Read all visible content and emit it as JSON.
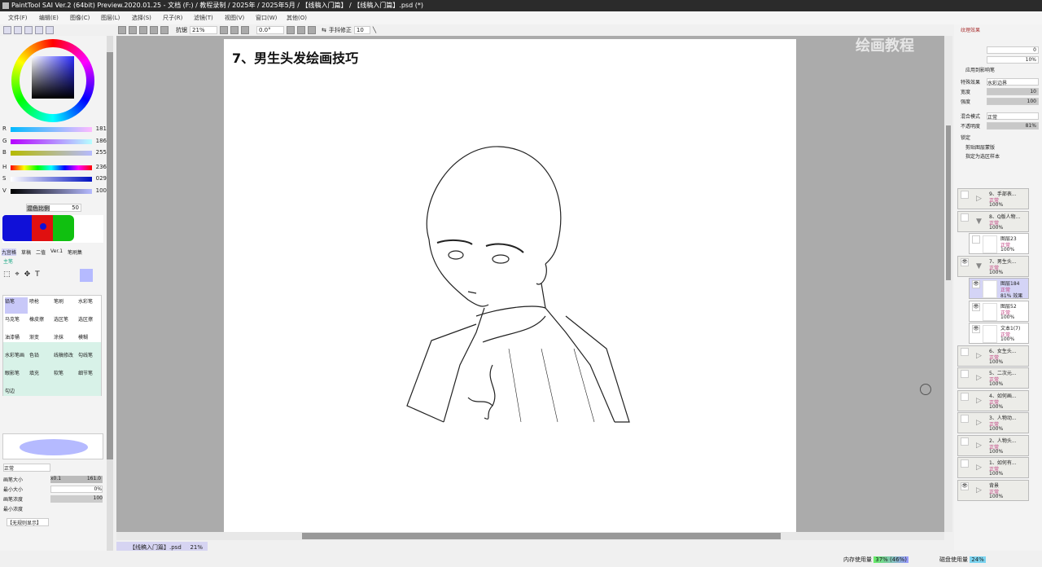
{
  "title": "PaintTool SAI Ver.2 (64bit) Preview.2020.01.25 - 文档 (F:) / 教程录制 / 2025年 / 2025年5月 / 【线稿入门篇】 / 【线稿入门篇】.psd (*)",
  "menu": [
    "文件(F)",
    "编辑(E)",
    "图像(C)",
    "图层(L)",
    "选择(S)",
    "尺子(R)",
    "滤镜(T)",
    "视图(V)",
    "窗口(W)",
    "其他(O)"
  ],
  "toolbar": {
    "zoom": "21%",
    "angle": "0.0°",
    "stabilizer_label": "手抖修正",
    "stabilizer": "10",
    "antialias": "抗锯"
  },
  "color": {
    "sliders": [
      {
        "l": "R",
        "v": "181"
      },
      {
        "l": "G",
        "v": "186"
      },
      {
        "l": "B",
        "v": "255"
      },
      {
        "l": "H",
        "v": "236"
      },
      {
        "l": "S",
        "v": "029"
      },
      {
        "l": "V",
        "v": "100"
      }
    ],
    "mix_label": "混色比例",
    "mix_value": "50"
  },
  "tool_tabs": [
    "九宫格",
    "草稿",
    "二值",
    "Ver.1",
    "笔刷集"
  ],
  "tool_set_label": "主笔",
  "tools": [
    "铅笔",
    "喷枪",
    "笔刷",
    "水彩笔",
    "马克笔",
    "橡皮擦",
    "选区笔",
    "选区擦",
    "油漆桶",
    "渐变",
    "涂抹",
    "模糊",
    "水彩笔画",
    "色铅",
    "线稿修改",
    "勾线笔",
    "眼影笔",
    "填充",
    "软笔",
    "细节笔",
    "勾边"
  ],
  "brush": {
    "mode": "正常",
    "size_label": "画笔大小",
    "size_mult": "x0.1",
    "size": "161.0",
    "min_size_label": "最小大小",
    "min_size": "0%",
    "density_label": "画笔浓度",
    "density": "100",
    "min_density_label": "最小浓度",
    "shape": "【无规则显示】"
  },
  "right": {
    "tex_label": "纹理效果",
    "r1": "0",
    "r2": "10%",
    "check1": "应用到影响笔",
    "effect_label": "特殊效果",
    "effect": "水彩边界",
    "width_label": "宽度",
    "width": "10",
    "strength_label": "强度",
    "strength": "100",
    "blend_label": "混合模式",
    "blend": "正常",
    "opacity_label": "不透明度",
    "opacity": "81%",
    "lock_label": "锁定",
    "clip": "剪贴图层蒙版",
    "ref": "指定为选区样本"
  },
  "layers": [
    {
      "name": "9、手部表...",
      "mode": "正常",
      "opacity": "100%"
    },
    {
      "name": "8、Q版人物...",
      "mode": "正常",
      "opacity": "100%",
      "open": true
    },
    {
      "name": "图层23",
      "mode": "正常",
      "opacity": "100%",
      "child": true
    },
    {
      "name": "7、男生头...",
      "mode": "正常",
      "opacity": "100%",
      "open": true,
      "visible": true
    },
    {
      "name": "图层184",
      "mode": "正常",
      "opacity": "81% 效果",
      "child": true,
      "selected": true,
      "visible": true
    },
    {
      "name": "图层52",
      "mode": "正常",
      "opacity": "100%",
      "child": true,
      "visible": true
    },
    {
      "name": "文本1(7)",
      "mode": "正常",
      "opacity": "100%",
      "child": true,
      "visible": true
    },
    {
      "name": "6、女生头...",
      "mode": "正常",
      "opacity": "100%"
    },
    {
      "name": "5、二次元...",
      "mode": "正常",
      "opacity": "100%"
    },
    {
      "name": "4、如何画...",
      "mode": "正常",
      "opacity": "100%"
    },
    {
      "name": "3、人物动...",
      "mode": "正常",
      "opacity": "100%"
    },
    {
      "name": "2、人物头...",
      "mode": "正常",
      "opacity": "100%"
    },
    {
      "name": "1、如何有...",
      "mode": "正常",
      "opacity": "100%"
    },
    {
      "name": "背景",
      "mode": "正常",
      "opacity": "100%",
      "visible": true
    }
  ],
  "canvas": {
    "heading": "7、男生头发绘画技巧",
    "watermark": "绘画教程"
  },
  "file_tab": {
    "name": "【线稿入门篇】.psd",
    "zoom": "21%"
  },
  "status": {
    "mem_label": "内存使用量",
    "mem": "37% (46%)",
    "disk_label": "磁盘使用量",
    "disk": "24%"
  }
}
